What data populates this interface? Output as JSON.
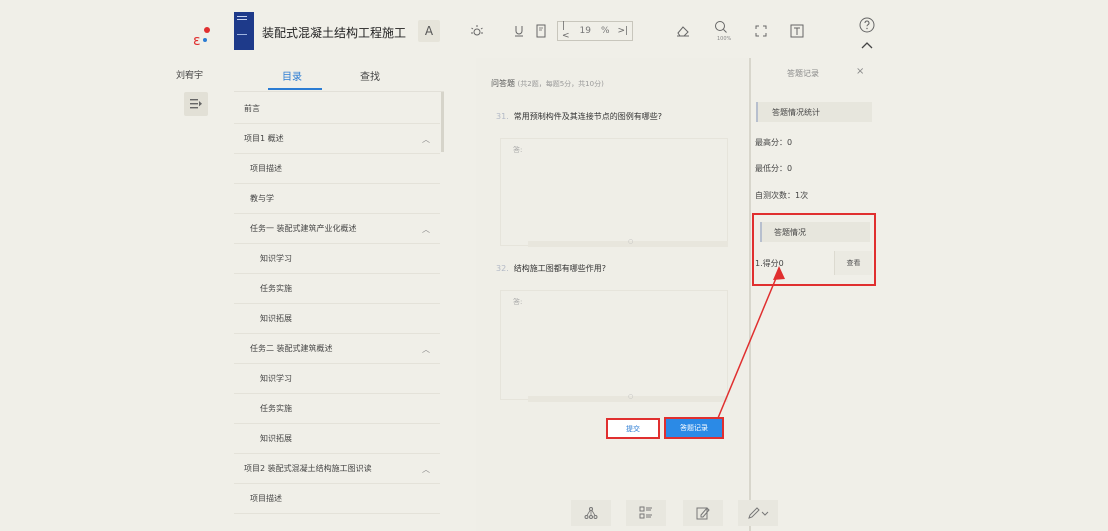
{
  "user": {
    "name": "刘宥宇"
  },
  "toolbar": {
    "book_title": "装配式混凝土结构工程施工",
    "font_label": "A",
    "page_current": "19",
    "page_sep": "%",
    "zoom": "100%"
  },
  "sidebar": {
    "tab_toc": "目录",
    "tab_search": "查找",
    "items": [
      {
        "label": "前言",
        "level": 0,
        "expandable": false
      },
      {
        "label": "项目1 概述",
        "level": 0,
        "expandable": true
      },
      {
        "label": "项目描述",
        "level": 1,
        "expandable": false
      },
      {
        "label": "教与学",
        "level": 1,
        "expandable": false
      },
      {
        "label": "任务一 装配式建筑产业化概述",
        "level": 1,
        "expandable": true
      },
      {
        "label": "知识学习",
        "level": 2,
        "expandable": false
      },
      {
        "label": "任务实施",
        "level": 2,
        "expandable": false
      },
      {
        "label": "知识拓展",
        "level": 2,
        "expandable": false
      },
      {
        "label": "任务二 装配式建筑概述",
        "level": 1,
        "expandable": true
      },
      {
        "label": "知识学习",
        "level": 2,
        "expandable": false
      },
      {
        "label": "任务实施",
        "level": 2,
        "expandable": false
      },
      {
        "label": "知识拓展",
        "level": 2,
        "expandable": false
      },
      {
        "label": "项目2 装配式混凝土结构施工图识读",
        "level": 0,
        "expandable": true
      },
      {
        "label": "项目描述",
        "level": 1,
        "expandable": false
      }
    ]
  },
  "main": {
    "section_title": "问答题",
    "section_sub": "(共2题，每题5分，共10分)",
    "questions": [
      {
        "num": "31.",
        "text": "常用预制构件及其连接节点的图例有哪些?",
        "answer_label": "答:"
      },
      {
        "num": "32.",
        "text": "结构施工图都有哪些作用?",
        "answer_label": "答:"
      }
    ],
    "submit_label": "提交",
    "record_label": "答题记录"
  },
  "panel": {
    "title": "答题记录",
    "close": "×",
    "stats_title": "答题情况统计",
    "max_score": "最高分：0",
    "min_score": "最低分：0",
    "attempts": "自测次数：1次",
    "result_title": "答题情况",
    "score_line": "1.得分0",
    "view_label": "查看"
  },
  "colors": {
    "accent": "#2b7cd3",
    "highlight": "#e02f2f",
    "background": "#f0efe8"
  },
  "icons": [
    "brightness-icon",
    "underline-icon",
    "bookmark-icon",
    "eraser-icon",
    "zoom-icon",
    "fullscreen-icon",
    "text-box-icon",
    "help-icon",
    "collapse-icon",
    "menu-toggle-icon",
    "mindmap-icon",
    "list-icon",
    "note-icon",
    "highlighter-icon"
  ]
}
